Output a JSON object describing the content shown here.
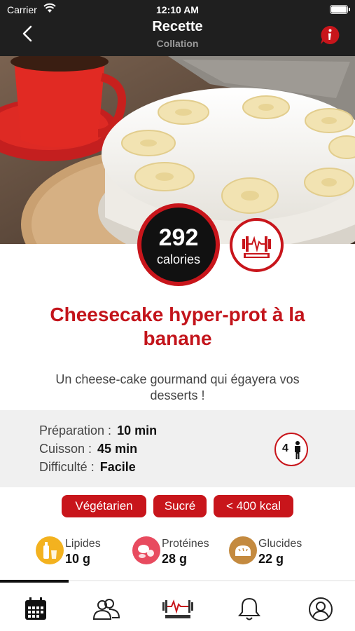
{
  "status_bar": {
    "carrier": "Carrier",
    "time": "12:10 AM"
  },
  "header": {
    "title": "Recette",
    "subtitle": "Collation"
  },
  "calories": {
    "value": "292",
    "unit": "calories"
  },
  "recipe": {
    "title": "Cheesecake hyper-prot à la banane",
    "description": "Un cheese-cake gourmand qui égayera vos desserts !"
  },
  "meta": {
    "preparation_label": "Préparation :",
    "preparation_value": "10 min",
    "cuisson_label": "Cuisson :",
    "cuisson_value": "45 min",
    "difficulte_label": "Difficulté :",
    "difficulte_value": "Facile",
    "servings": "4"
  },
  "tags": [
    "Végétarien",
    "Sucré",
    "< 400 kcal"
  ],
  "macros": [
    {
      "label": "Lipides",
      "value": "10 g",
      "color": "#f3b21f"
    },
    {
      "label": "Protéines",
      "value": "28 g",
      "color": "#e84b5f"
    },
    {
      "label": "Glucides",
      "value": "22 g",
      "color": "#c48a3f"
    }
  ],
  "colors": {
    "accent": "#c8151b",
    "header_bg": "#1f1f1f"
  },
  "tabbar": {
    "icons": [
      "calendar-icon",
      "community-icon",
      "leadfit-logo",
      "bell-icon",
      "profile-icon"
    ]
  }
}
